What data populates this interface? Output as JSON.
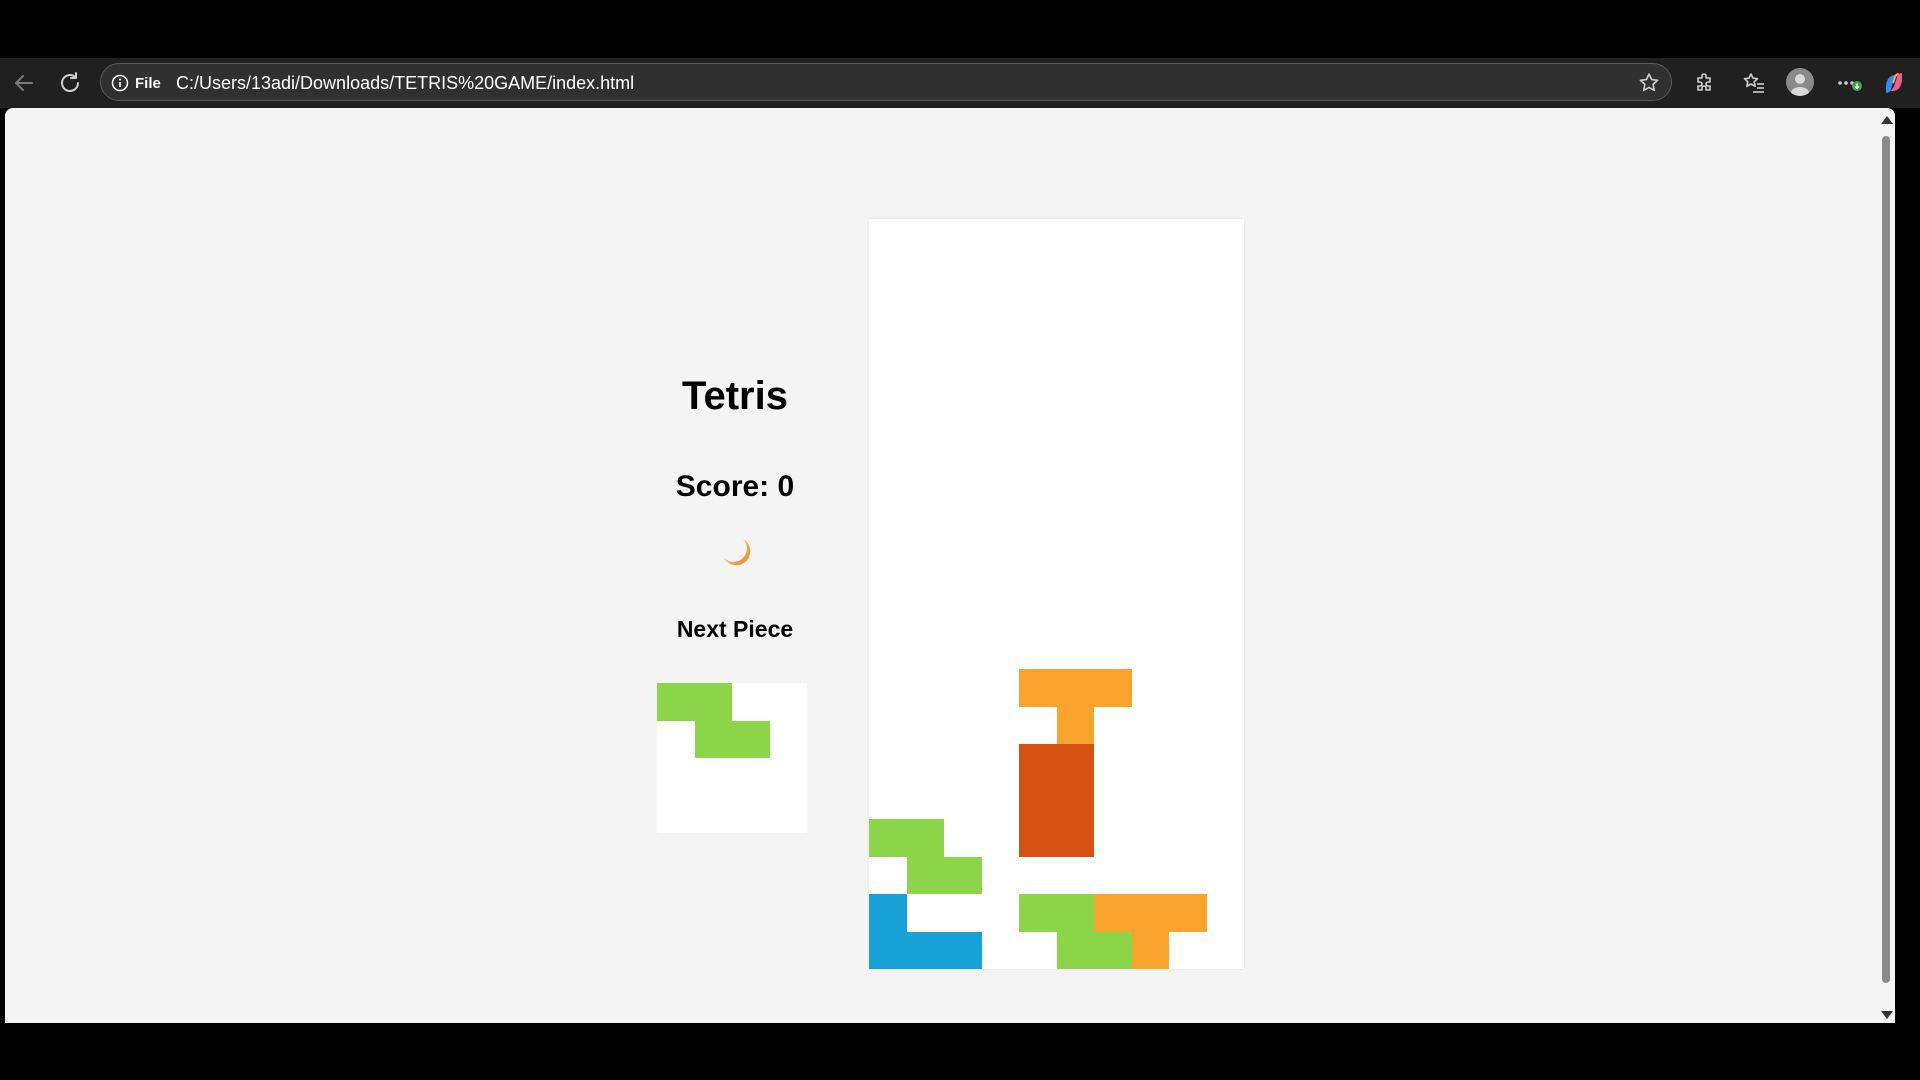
{
  "browser": {
    "site_info_label": "File",
    "url": "C:/Users/13adi/Downloads/TETRIS%20GAME/index.html"
  },
  "game": {
    "title": "Tetris",
    "score_label": "Score:",
    "score": 0,
    "score_text": "Score: 0",
    "theme_toggle_icon": "crescent-moon-icon",
    "next_piece_label": "Next Piece"
  },
  "colors": {
    "green": "#8cd448",
    "orange": "#f8a42e",
    "red_orange": "#d65213",
    "blue": "#18a2d8",
    "page_bg": "#f4f4f4"
  },
  "board": {
    "cols": 10,
    "rows": 20,
    "cells": [
      {
        "row": 12,
        "col": 4,
        "color": "orange"
      },
      {
        "row": 12,
        "col": 5,
        "color": "orange"
      },
      {
        "row": 12,
        "col": 6,
        "color": "orange"
      },
      {
        "row": 13,
        "col": 5,
        "color": "orange"
      },
      {
        "row": 14,
        "col": 4,
        "color": "red_orange"
      },
      {
        "row": 14,
        "col": 5,
        "color": "red_orange"
      },
      {
        "row": 15,
        "col": 4,
        "color": "red_orange"
      },
      {
        "row": 15,
        "col": 5,
        "color": "red_orange"
      },
      {
        "row": 16,
        "col": 4,
        "color": "red_orange"
      },
      {
        "row": 16,
        "col": 5,
        "color": "red_orange"
      },
      {
        "row": 16,
        "col": 0,
        "color": "green"
      },
      {
        "row": 16,
        "col": 1,
        "color": "green"
      },
      {
        "row": 17,
        "col": 1,
        "color": "green"
      },
      {
        "row": 17,
        "col": 2,
        "color": "green"
      },
      {
        "row": 18,
        "col": 0,
        "color": "blue"
      },
      {
        "row": 19,
        "col": 0,
        "color": "blue"
      },
      {
        "row": 19,
        "col": 1,
        "color": "blue"
      },
      {
        "row": 19,
        "col": 2,
        "color": "blue"
      },
      {
        "row": 18,
        "col": 4,
        "color": "green"
      },
      {
        "row": 18,
        "col": 5,
        "color": "green"
      },
      {
        "row": 19,
        "col": 5,
        "color": "green"
      },
      {
        "row": 19,
        "col": 6,
        "color": "green"
      },
      {
        "row": 18,
        "col": 6,
        "color": "orange"
      },
      {
        "row": 18,
        "col": 7,
        "color": "orange"
      },
      {
        "row": 18,
        "col": 8,
        "color": "orange"
      },
      {
        "row": 19,
        "col": 7,
        "color": "orange"
      }
    ]
  },
  "next_piece": {
    "color": "green",
    "cells": [
      {
        "row": 0,
        "col": 0
      },
      {
        "row": 0,
        "col": 1
      },
      {
        "row": 1,
        "col": 1
      },
      {
        "row": 1,
        "col": 2
      }
    ]
  }
}
